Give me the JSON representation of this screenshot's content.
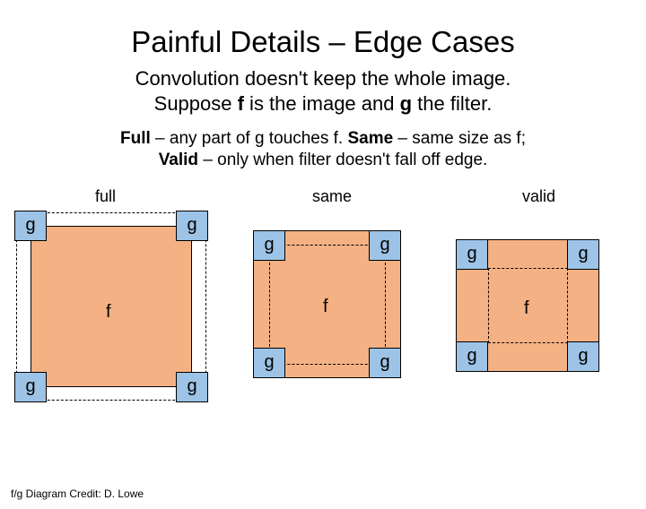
{
  "title": "Painful Details – Edge Cases",
  "subtitle_line1": "Convolution doesn't keep the whole image.",
  "subtitle_line2_a": "Suppose ",
  "subtitle_line2_b": "f",
  "subtitle_line2_c": " is the image and ",
  "subtitle_line2_d": "g",
  "subtitle_line2_e": " the filter.",
  "def_full_label": "Full",
  "def_full_text": " – any part of g touches f. ",
  "def_same_label": "Same",
  "def_same_text": " – same size as f;",
  "def_valid_label": "Valid",
  "def_valid_text": " – only when filter doesn't fall off edge.",
  "labels": {
    "full": "full",
    "same": "same",
    "valid": "valid",
    "f": "f",
    "g": "g"
  },
  "credit": "f/g Diagram Credit: D. Lowe"
}
